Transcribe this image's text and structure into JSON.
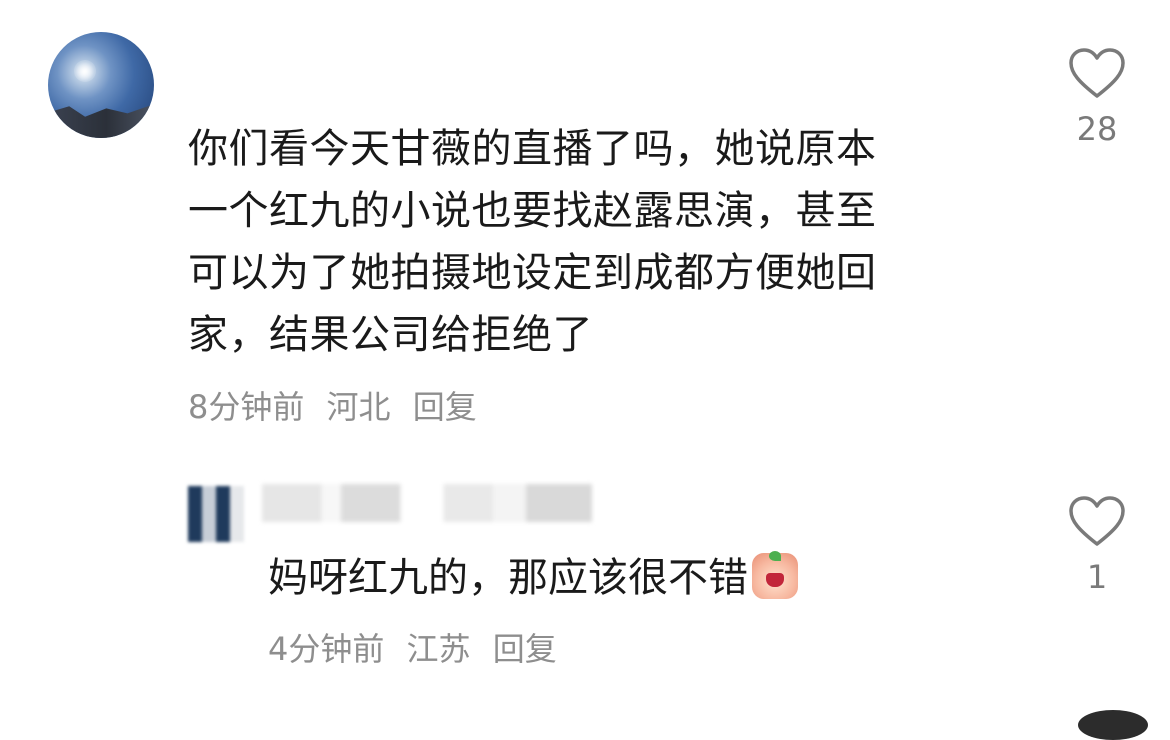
{
  "comment": {
    "lines": [
      "你们看今天甘薇的直播了吗，她说原本",
      "一个红九的小说也要找赵露思演，甚至",
      "可以为了她拍摄地设定到成都方便她回",
      "家，结果公司给拒绝了"
    ],
    "time": "8分钟前",
    "location": "河北",
    "reply_label": "回复",
    "like_count": "28",
    "like_icon": "heart-outline-icon"
  },
  "reply": {
    "text": "妈呀红九的，那应该很不错",
    "emoji": "laughing-peach-emoji",
    "time": "4分钟前",
    "location": "江苏",
    "reply_label": "回复",
    "like_count": "1",
    "like_icon": "heart-outline-icon"
  },
  "colors": {
    "text": "#1a1a1a",
    "meta": "#8e8e8e",
    "icon": "#7a7a7a"
  }
}
